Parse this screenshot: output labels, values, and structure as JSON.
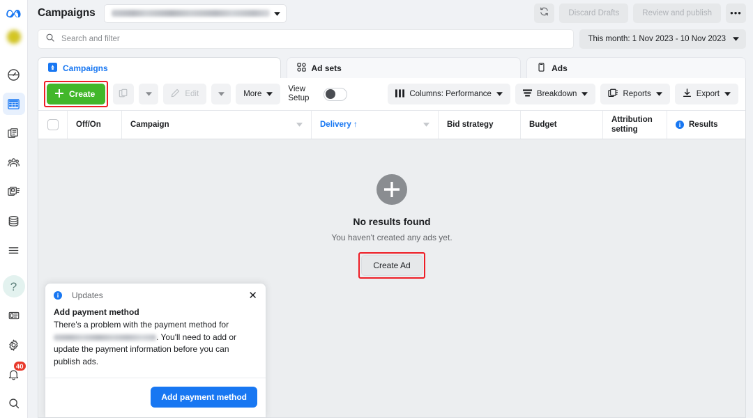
{
  "rail": {
    "logo": "meta-logo",
    "items": [
      {
        "name": "dashboard-gauge",
        "icon": "gauge-icon",
        "active": false
      },
      {
        "name": "campaigns-table",
        "icon": "table-icon",
        "active": true
      },
      {
        "name": "pages-library",
        "icon": "pages-icon",
        "active": false
      },
      {
        "name": "audiences",
        "icon": "people-icon",
        "active": false
      },
      {
        "name": "ads-media",
        "icon": "media-icon",
        "active": false
      },
      {
        "name": "billing",
        "icon": "coins-icon",
        "active": false
      },
      {
        "name": "all-tools",
        "icon": "menu-icon",
        "active": false
      }
    ],
    "bottom": [
      {
        "name": "help",
        "icon": "question-icon",
        "label": "?"
      },
      {
        "name": "news",
        "icon": "news-card-icon"
      },
      {
        "name": "settings",
        "icon": "gear-icon"
      },
      {
        "name": "notifications",
        "icon": "bell-icon",
        "badge": "40"
      },
      {
        "name": "search",
        "icon": "search-icon"
      }
    ]
  },
  "header": {
    "title": "Campaigns",
    "account_selector_value": "",
    "refresh_icon": "refresh-icon",
    "discard_drafts": "Discard Drafts",
    "review_publish": "Review and publish",
    "more_options": "•••"
  },
  "search": {
    "placeholder": "Search and filter",
    "value": "",
    "icon": "search-icon"
  },
  "date_range": {
    "label": "This month: 1 Nov 2023 - 10 Nov 2023"
  },
  "tabs": [
    {
      "label": "Campaigns",
      "icon": "campaign-icon",
      "active": true
    },
    {
      "label": "Ad sets",
      "icon": "adsets-icon",
      "active": false
    },
    {
      "label": "Ads",
      "icon": "ads-icon",
      "active": false
    }
  ],
  "toolbar": {
    "create_label": "Create",
    "duplicate_icon": "duplicate-icon",
    "edit_label": "Edit",
    "edit_icon": "pencil-icon",
    "more_label": "More",
    "view_setup_label": "View\nSetup",
    "view_setup_line1": "View",
    "view_setup_line2": "Setup",
    "view_setup_on": false,
    "columns_label": "Columns: Performance",
    "breakdown_label": "Breakdown",
    "reports_label": "Reports",
    "export_label": "Export"
  },
  "table": {
    "columns": [
      {
        "label": "Off/On",
        "sorted": false
      },
      {
        "label": "Campaign",
        "sorted": false,
        "caret": true
      },
      {
        "label": "Delivery ↑",
        "sorted": true,
        "caret": true
      },
      {
        "label": "Bid strategy",
        "sorted": false
      },
      {
        "label": "Budget",
        "sorted": false
      },
      {
        "label": "Attribution setting",
        "sorted": false
      },
      {
        "label": "Results",
        "sorted": false,
        "info": true
      }
    ],
    "rows": []
  },
  "empty_state": {
    "icon": "plus-circle-icon",
    "title": "No results found",
    "subtitle": "You haven't created any ads yet.",
    "button_label": "Create Ad"
  },
  "updates_card": {
    "panel_title": "Updates",
    "info_icon": "info-icon",
    "close_icon": "close-icon",
    "heading": "Add payment method",
    "body_before": "There's a problem with the payment method for",
    "body_account": "",
    "body_after": ". You'll need to add or update the payment information before you can publish ads.",
    "button_label": "Add payment method"
  },
  "colors": {
    "brand_blue": "#1877f2",
    "create_green": "#42b72a",
    "annotation_red": "#ee1c25",
    "badge_red": "#e8392b",
    "page_bg": "#f0f2f5"
  }
}
